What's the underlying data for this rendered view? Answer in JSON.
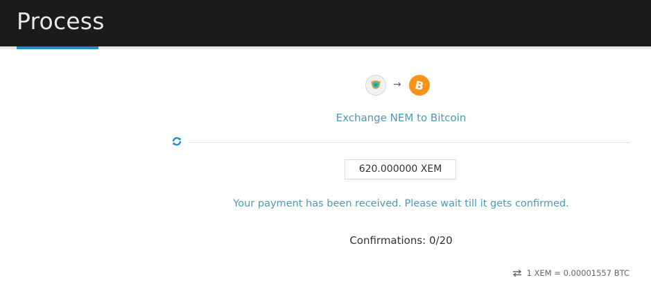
{
  "header": {
    "title": "Process"
  },
  "exchange": {
    "from_icon": "nem-icon",
    "to_icon": "bitcoin-icon",
    "arrow": "→",
    "title": "Exchange NEM to Bitcoin"
  },
  "payment": {
    "amount": "620.000000 XEM",
    "status": "Your payment has been received. Please wait till it gets confirmed.",
    "confirmations": "Confirmations: 0/20"
  },
  "rate": {
    "text": "1 XEM = 0.00001557 BTC"
  },
  "colors": {
    "header_bg": "#1b1b1b",
    "accent": "#1e90c8",
    "link_text": "#4b9bb5",
    "bitcoin": "#f7931a"
  }
}
